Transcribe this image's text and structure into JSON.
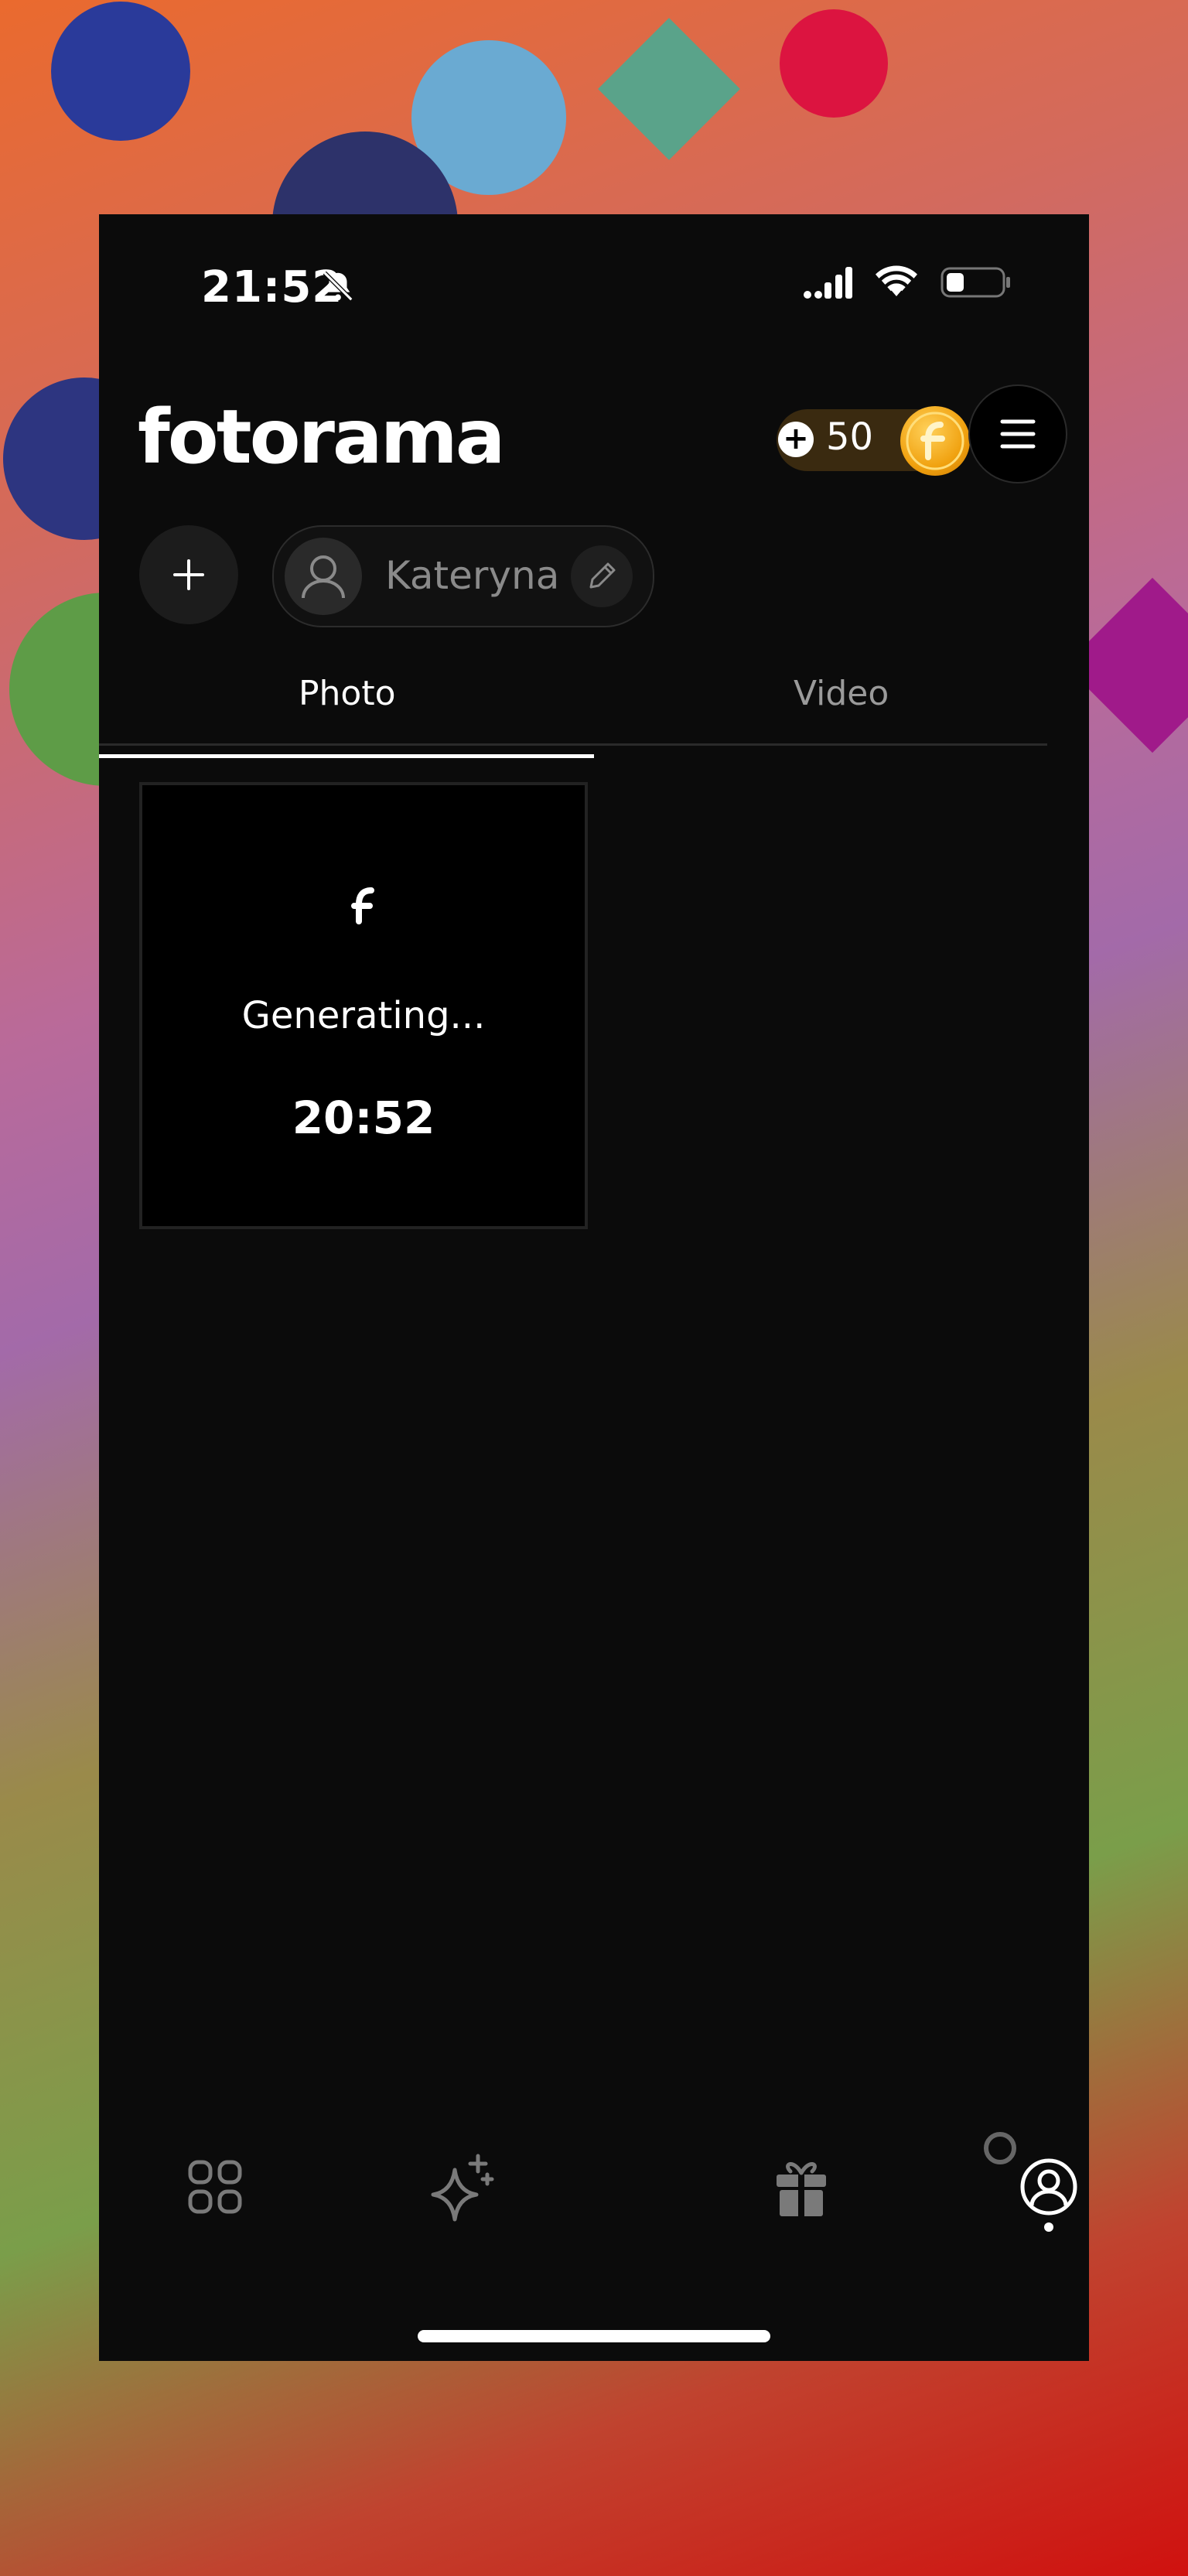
{
  "status_bar": {
    "time": "21:52"
  },
  "header": {
    "logo": "fotorama",
    "coin_count": "50",
    "add_coins_symbol": "+",
    "menu_icon": "menu-icon"
  },
  "profile": {
    "add_symbol": "+",
    "name": "Kateryna"
  },
  "tabs": [
    {
      "label": "Photo",
      "active": true
    },
    {
      "label": "Video",
      "active": false
    }
  ],
  "gallery": {
    "items": [
      {
        "status": "Generating...",
        "time": "20:52"
      }
    ]
  },
  "bottom_nav": {
    "items": [
      {
        "icon": "grid-icon",
        "active": false
      },
      {
        "icon": "sparkle-icon",
        "active": false
      },
      {
        "icon": "gift-icon",
        "active": false
      },
      {
        "icon": "profile-icon",
        "active": true
      }
    ]
  },
  "colors": {
    "background": "#0b0b0b",
    "accent_coin": "#f0a10f",
    "text_primary": "#ffffff",
    "text_muted": "#8a8a8a"
  }
}
